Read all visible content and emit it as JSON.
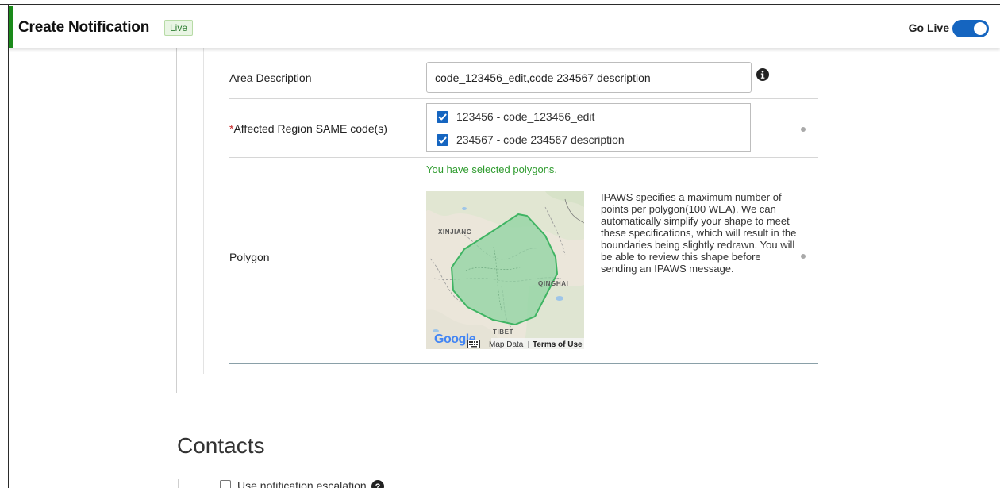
{
  "header": {
    "title": "Create Notification",
    "status_badge": "Live",
    "go_live_label": "Go Live",
    "go_live_enabled": true,
    "accent_color": "#1a8a1a",
    "toggle_color": "#1565c0"
  },
  "area_description": {
    "label": "Area Description",
    "value": "code_123456_edit,code 234567 description",
    "info_icon": "info-circle-icon"
  },
  "affected_region": {
    "required_marker": "*",
    "label": "Affected Region SAME code(s)",
    "items": [
      {
        "label": "123456 - code_123456_edit",
        "checked": true
      },
      {
        "label": "234567 - code 234567 description",
        "checked": true
      }
    ]
  },
  "polygon": {
    "label": "Polygon",
    "selected_message": "You have selected polygons.",
    "description": "IPAWS specifies a maximum number of points per polygon(100 WEA). We can automatically simplify your shape to meet these specifications, which will result in the boundaries being slightly redrawn. You will be able to review this shape before sending an IPAWS message.",
    "map": {
      "region_labels": [
        "XINJIANG",
        "QINGHAI",
        "TIBET"
      ],
      "logo_text": "Google",
      "map_data_label": "Map Data",
      "terms_label": "Terms of Use",
      "polygon_color": "#43b968"
    }
  },
  "contacts": {
    "title": "Contacts",
    "partial_option": "Use notification escalation",
    "help_icon": "question-circle-icon"
  }
}
